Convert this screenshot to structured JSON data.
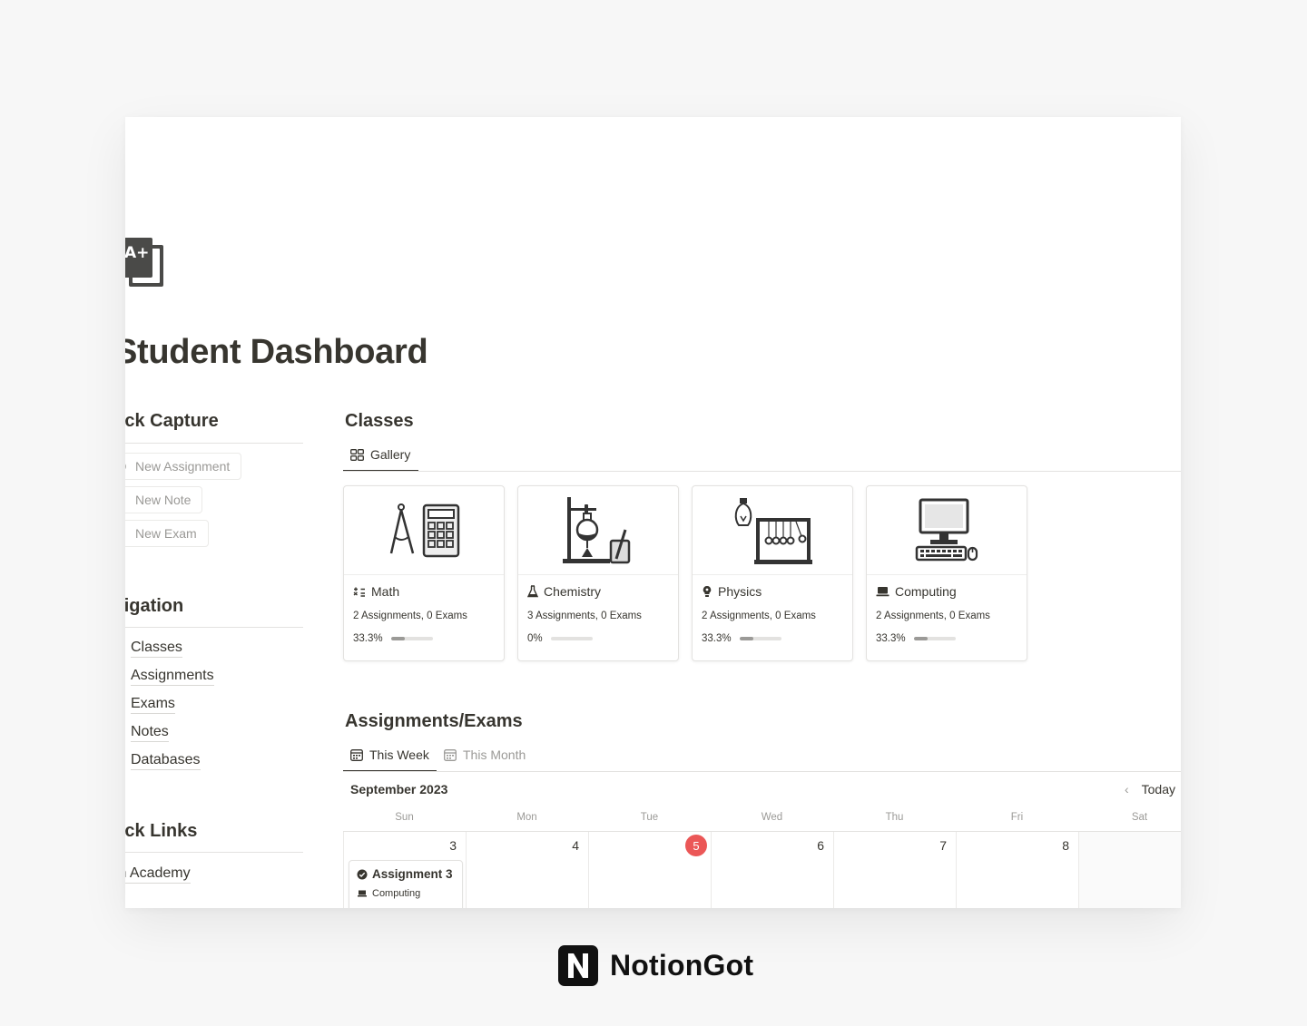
{
  "page": {
    "title": "Student Dashboard",
    "icon": "grade-book-icon"
  },
  "quick_capture": {
    "heading": "Quick Capture",
    "buttons": [
      {
        "label": "New Assignment",
        "icon": "pin-icon"
      },
      {
        "label": "New Note",
        "icon": "exclamation-icon"
      },
      {
        "label": "New Exam",
        "icon": "pencil-icon"
      }
    ]
  },
  "navigation": {
    "heading": "Navigation",
    "links": [
      "Classes",
      "Assignments",
      "Exams",
      "Notes",
      "Databases"
    ]
  },
  "quick_links": {
    "heading": "Quick Links",
    "links": [
      "Khan Academy"
    ]
  },
  "classes": {
    "heading": "Classes",
    "view_tab": {
      "label": "Gallery",
      "icon": "gallery-icon"
    },
    "cards": [
      {
        "name": "Math",
        "icon": "math-symbols-icon",
        "cover": "compass-calculator-icon",
        "summary": "2 Assignments, 0 Exams",
        "progress_label": "33.3%",
        "progress": 0.333
      },
      {
        "name": "Chemistry",
        "icon": "flask-icon",
        "cover": "lab-equipment-icon",
        "summary": "3 Assignments, 0 Exams",
        "progress_label": "0%",
        "progress": 0.0
      },
      {
        "name": "Physics",
        "icon": "lightbulb-icon",
        "cover": "newtons-cradle-icon",
        "summary": "2 Assignments, 0 Exams",
        "progress_label": "33.3%",
        "progress": 0.333
      },
      {
        "name": "Computing",
        "icon": "laptop-icon",
        "cover": "desktop-computer-icon",
        "summary": "2 Assignments, 0 Exams",
        "progress_label": "33.3%",
        "progress": 0.333
      }
    ]
  },
  "assignments": {
    "heading": "Assignments/Exams",
    "tabs": [
      {
        "label": "This Week",
        "icon": "calendar-icon",
        "active": true
      },
      {
        "label": "This Month",
        "icon": "calendar-icon",
        "active": false
      }
    ],
    "calendar": {
      "month_label": "September 2023",
      "today_label": "Today",
      "weekdays": [
        "Sun",
        "Mon",
        "Tue",
        "Wed",
        "Thu",
        "Fri",
        "Sat"
      ],
      "days": [
        "3",
        "4",
        "5",
        "6",
        "7",
        "8",
        ""
      ],
      "today_index": 2,
      "events": [
        {
          "day_index": 0,
          "title": "Assignment 3",
          "class_name": "Computing",
          "icon": "check-circle-icon"
        }
      ]
    }
  },
  "brand": {
    "name": "NotionGot",
    "logo": "notion-n-logo"
  },
  "colors": {
    "text": "#37352f",
    "muted": "#9b9a97",
    "today": "#eb5757",
    "border": "#e3e2e0"
  }
}
